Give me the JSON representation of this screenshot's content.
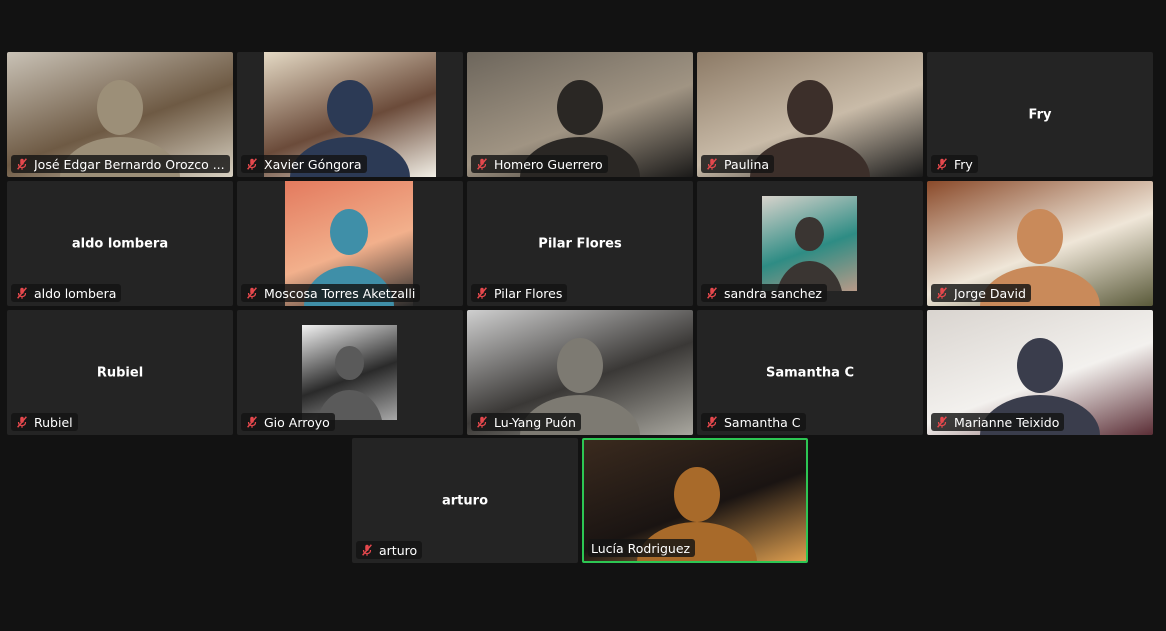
{
  "meeting": {
    "colors": {
      "background": "#121212",
      "tile": "#242424",
      "active_speaker": "#2dc653",
      "muted_icon": "#e5484d"
    },
    "participants": [
      {
        "name": "José Edgar Bernardo Orozco ...",
        "muted": true,
        "video": true,
        "photo": false,
        "palette": [
          "#c9c2b6",
          "#9c8f78",
          "#6e5a44",
          "#d8d1c2"
        ]
      },
      {
        "name": "Xavier Góngora",
        "muted": true,
        "video": true,
        "photo": false,
        "palette": [
          "#e4d9c4",
          "#2c3a55",
          "#6b4b3a",
          "#f2efe6"
        ]
      },
      {
        "name": "Homero Guerrero",
        "muted": true,
        "video": true,
        "photo": false,
        "palette": [
          "#6d665c",
          "#2a2724",
          "#a09483",
          "#1b1a19"
        ]
      },
      {
        "name": "Paulina",
        "muted": true,
        "video": true,
        "photo": false,
        "palette": [
          "#8c7a66",
          "#3c2f2a",
          "#c9bba8",
          "#1a1a1a"
        ]
      },
      {
        "name": "Fry",
        "muted": true,
        "video": false,
        "display_name": "Fry"
      },
      {
        "name": "aldo lombera",
        "muted": true,
        "video": false,
        "display_name": "aldo lombera"
      },
      {
        "name": "Moscosa Torres Aketzalli",
        "muted": true,
        "video": true,
        "photo": true,
        "palette": [
          "#e37a5e",
          "#3f8fa8",
          "#f2b08c",
          "#2a2a2a"
        ]
      },
      {
        "name": "Pilar Flores",
        "muted": true,
        "video": false,
        "display_name": "Pilar Flores"
      },
      {
        "name": "sandra sanchez",
        "muted": true,
        "video": true,
        "photo": true,
        "palette": [
          "#d8d3cc",
          "#3a3532",
          "#2e8c84",
          "#b89a88"
        ]
      },
      {
        "name": "Jorge David",
        "muted": true,
        "video": true,
        "photo": false,
        "palette": [
          "#8a4a2a",
          "#c98a5a",
          "#efe6d8",
          "#5a5a3a"
        ]
      },
      {
        "name": "Rubiel",
        "muted": true,
        "video": false,
        "display_name": "Rubiel"
      },
      {
        "name": "Gio Arroyo",
        "muted": true,
        "video": true,
        "photo": true,
        "palette": [
          "#f2f2f2",
          "#5a5a5a",
          "#2a2a2a",
          "#a8a8a8"
        ]
      },
      {
        "name": "Lu-Yang Puón",
        "muted": true,
        "video": true,
        "photo": false,
        "palette": [
          "#cfcfcf",
          "#7d7a72",
          "#3a3836",
          "#a9a79f"
        ]
      },
      {
        "name": "Samantha C",
        "muted": true,
        "video": false,
        "display_name": "Samantha C"
      },
      {
        "name": "Marianne Teixido",
        "muted": true,
        "video": true,
        "photo": false,
        "palette": [
          "#d9d4cf",
          "#3a3d4c",
          "#f3f1ee",
          "#5b2e36"
        ]
      },
      {
        "name": "arturo",
        "muted": true,
        "video": false,
        "display_name": "arturo"
      },
      {
        "name": "Lucía Rodriguez",
        "muted": false,
        "video": true,
        "photo": false,
        "active": true,
        "palette": [
          "#3a2a1e",
          "#a86a2a",
          "#1a1412",
          "#e0a050"
        ]
      }
    ]
  }
}
